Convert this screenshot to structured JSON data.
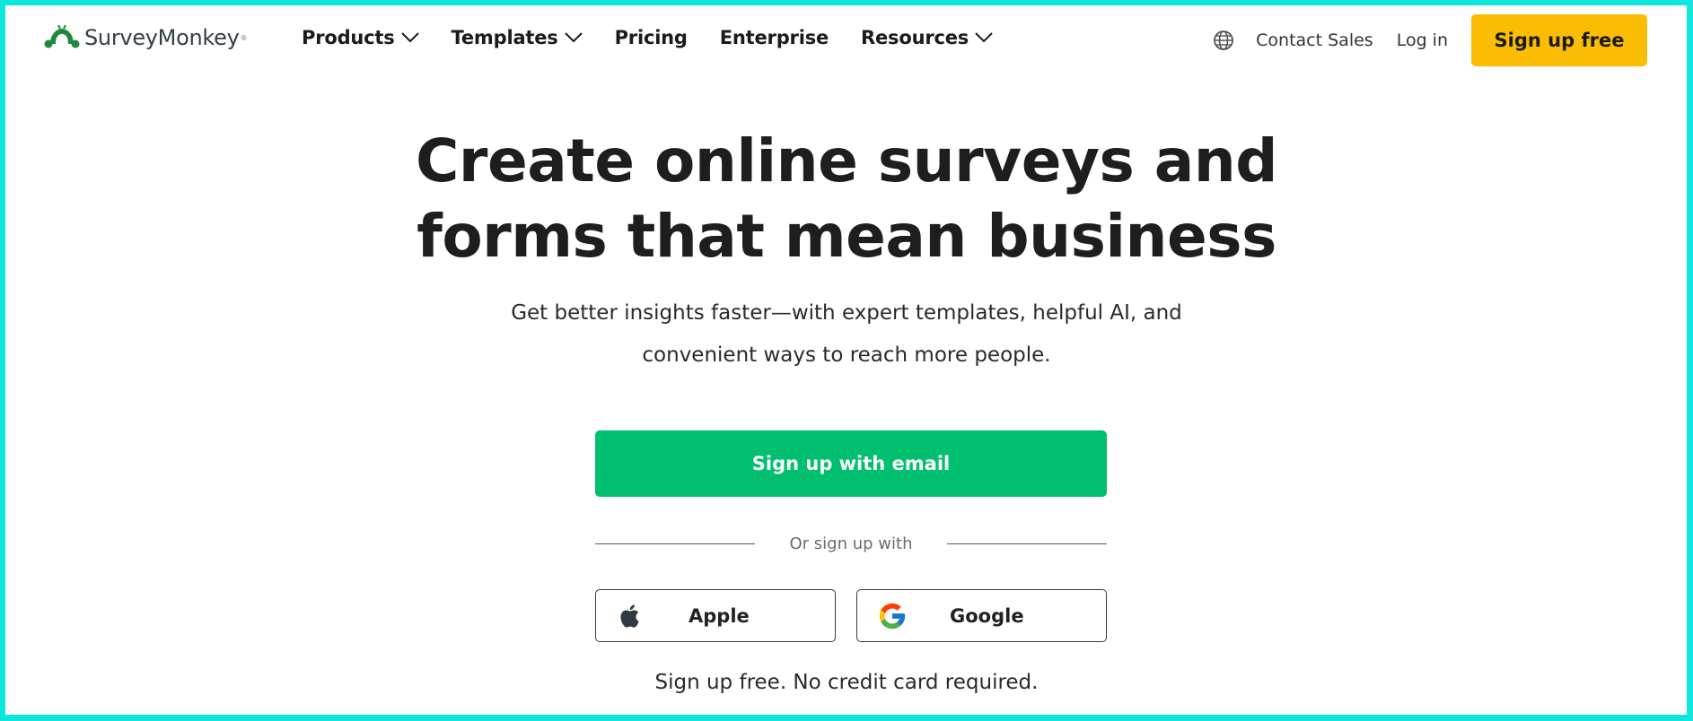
{
  "brand": {
    "name": "SurveyMonkey",
    "trademark": "®",
    "logo_icon": "surveymonkey-logo-icon",
    "color": "#00bf6f"
  },
  "nav": {
    "items": [
      {
        "label": "Products",
        "has_dropdown": true
      },
      {
        "label": "Templates",
        "has_dropdown": true
      },
      {
        "label": "Pricing",
        "has_dropdown": false
      },
      {
        "label": "Enterprise",
        "has_dropdown": false
      },
      {
        "label": "Resources",
        "has_dropdown": true
      }
    ],
    "language_icon": "globe-icon",
    "contact_sales": "Contact Sales",
    "log_in": "Log in",
    "sign_up_free": "Sign up free",
    "sign_up_color": "#fbbd04"
  },
  "hero": {
    "title_line1": "Create online surveys and",
    "title_line2": "forms that mean business",
    "subtitle_line1": "Get better insights faster—with expert templates, helpful AI, and",
    "subtitle_line2": "convenient ways to reach more people.",
    "email_button": "Sign up with email",
    "email_button_color": "#00bf6f",
    "divider_text": "Or sign up with",
    "social": [
      {
        "label": "Apple",
        "icon": "apple-icon"
      },
      {
        "label": "Google",
        "icon": "google-icon"
      }
    ],
    "footnote": "Sign up free. No credit card required."
  }
}
